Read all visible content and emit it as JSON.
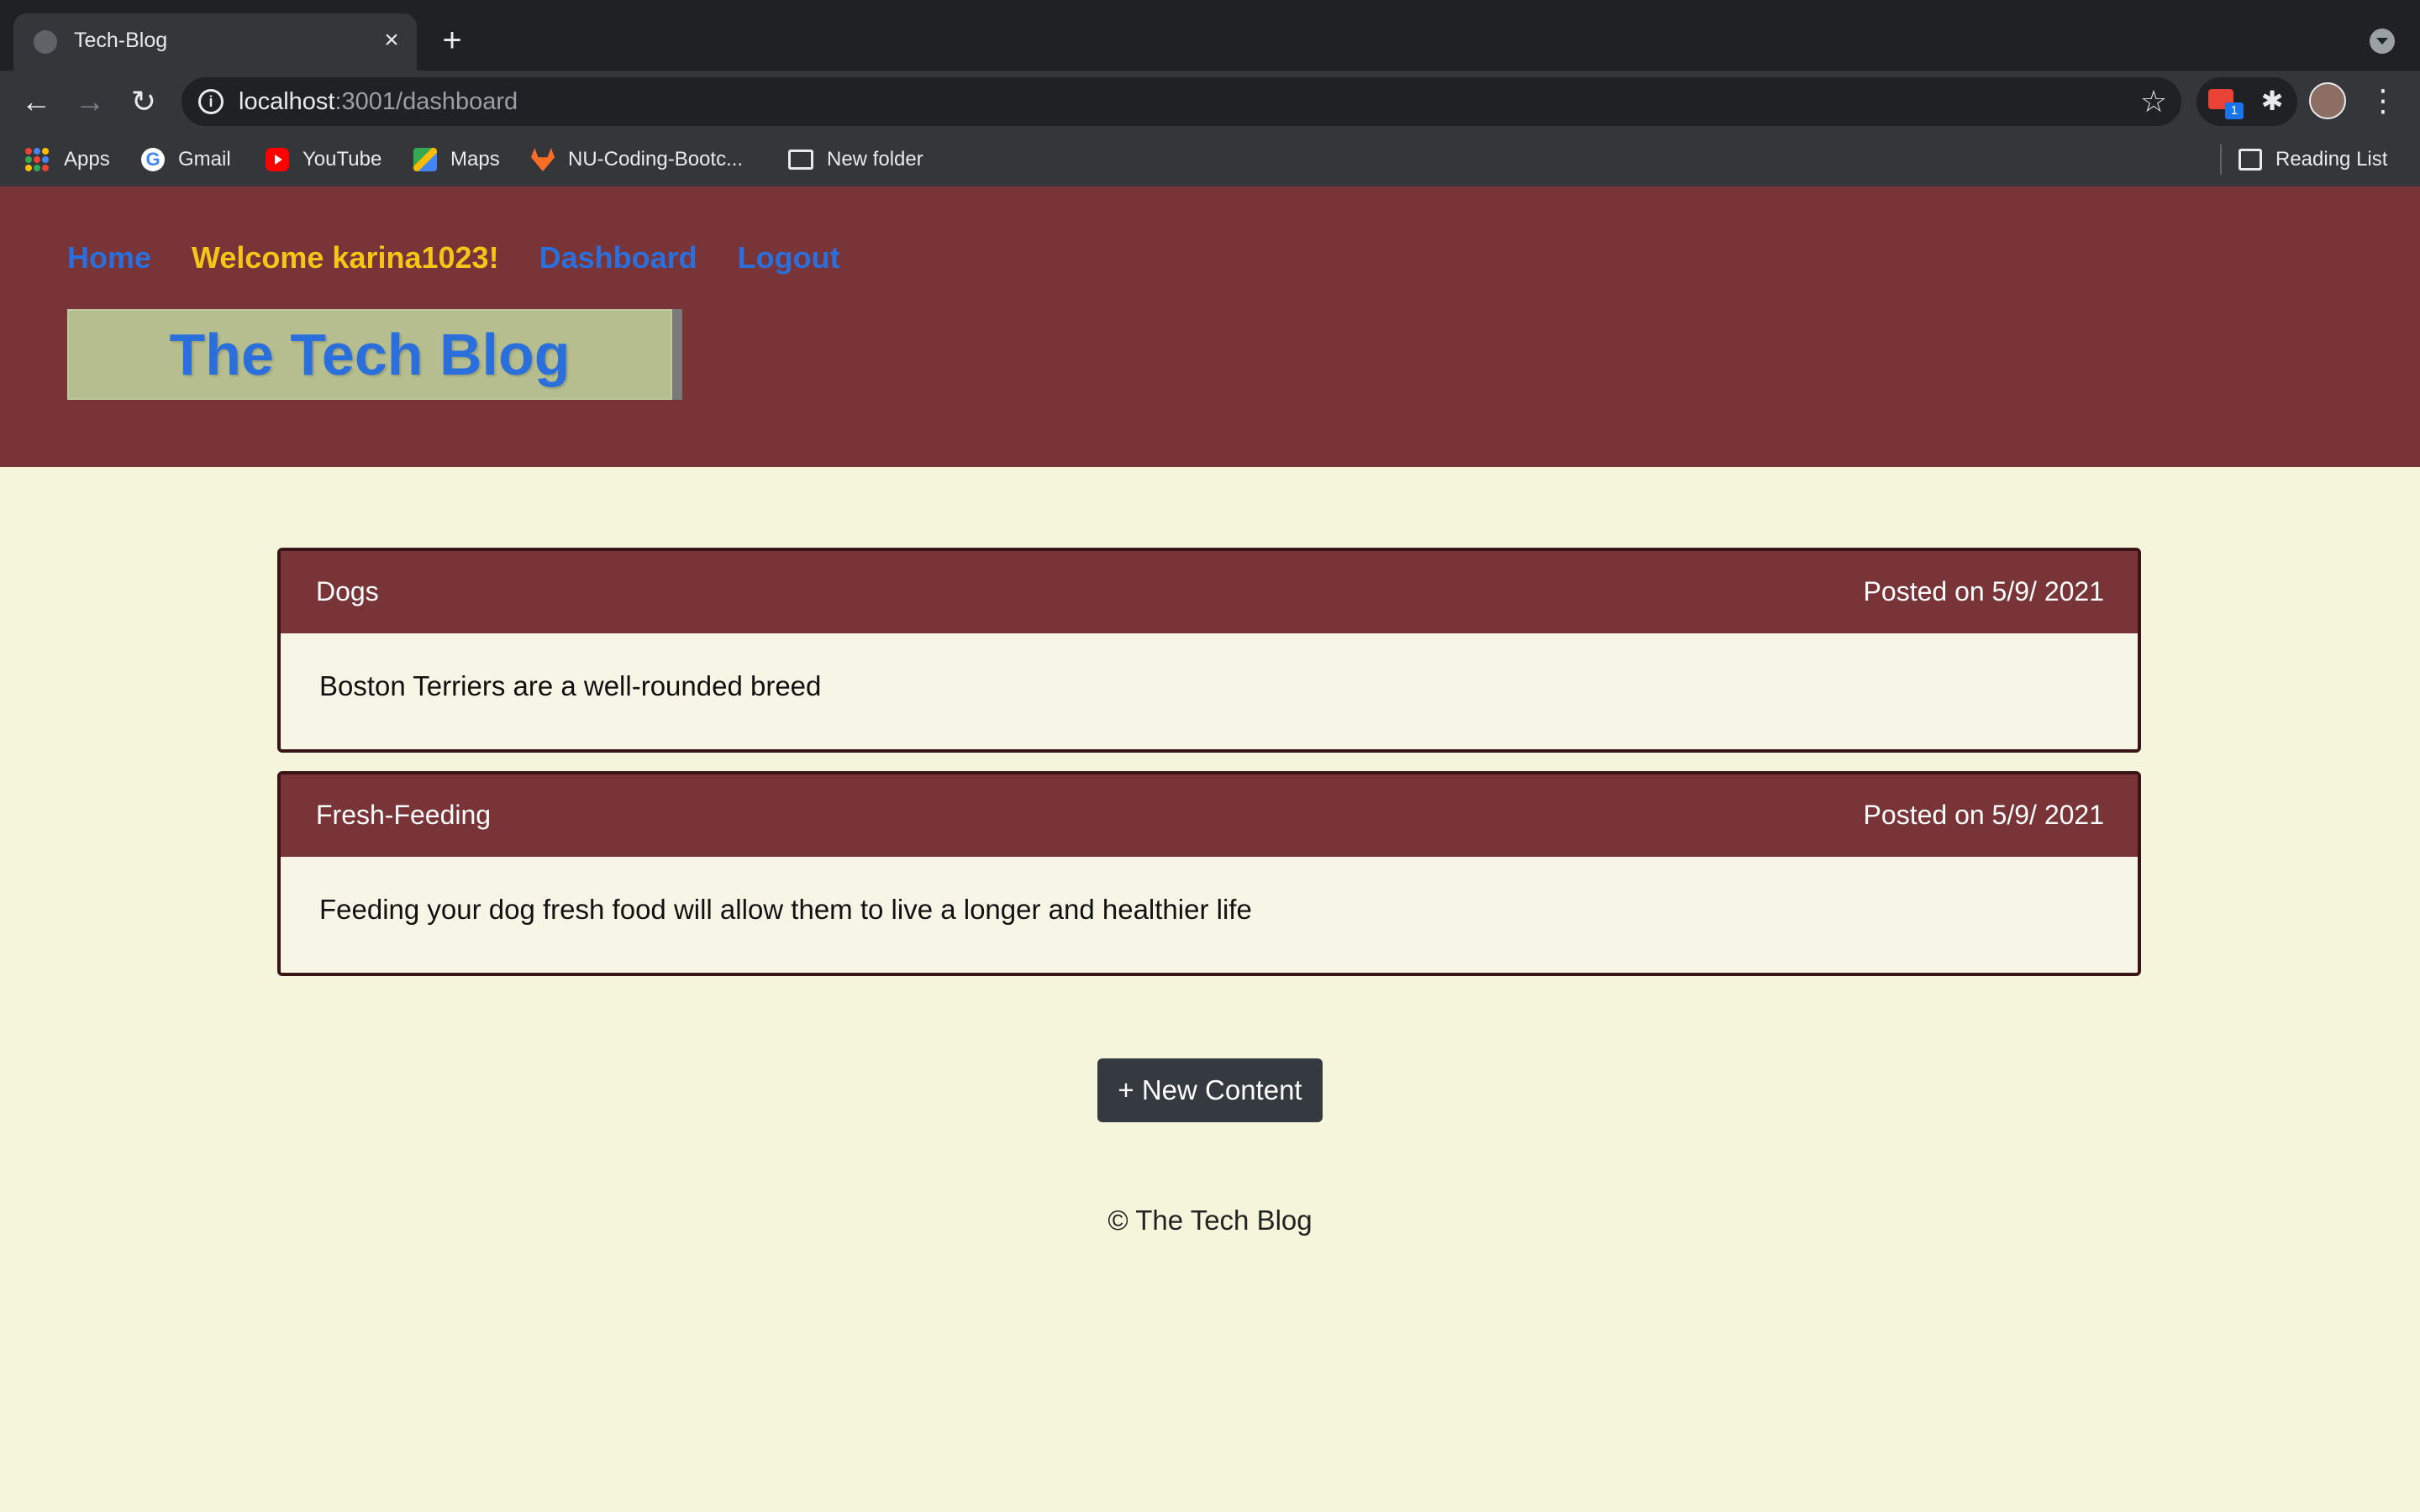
{
  "browser": {
    "tab_title": "Tech-Blog",
    "url_host": "localhost",
    "url_path": ":3001/dashboard",
    "extension_badge": "1",
    "bookmarks": [
      {
        "label": "Apps",
        "icon": "apps-grid-icon"
      },
      {
        "label": "Gmail",
        "icon": "google-icon"
      },
      {
        "label": "YouTube",
        "icon": "youtube-icon"
      },
      {
        "label": "Maps",
        "icon": "maps-icon"
      },
      {
        "label": "NU-Coding-Bootc...",
        "icon": "gitlab-icon"
      },
      {
        "label": "New folder",
        "icon": "folder-icon"
      }
    ],
    "reading_list": "Reading List"
  },
  "site": {
    "nav": {
      "home": "Home",
      "welcome": "Welcome karina1023!",
      "dashboard": "Dashboard",
      "logout": "Logout"
    },
    "logo": "The Tech Blog",
    "colors": {
      "header_bg": "#793438",
      "page_bg": "#f5f5dc",
      "nav_link": "#2a6fdb",
      "welcome": "#f5c518",
      "logo_bg": "#b6be8f",
      "button_bg": "#343a40"
    }
  },
  "posts": [
    {
      "title": "Dogs",
      "date": "Posted on 5/9/ 2021",
      "content": "Boston Terriers are a well-rounded breed"
    },
    {
      "title": "Fresh-Feeding",
      "date": "Posted on 5/9/ 2021",
      "content": "Feeding your dog fresh food will allow them to live a longer and healthier life"
    }
  ],
  "new_content_button": "+ New Content",
  "footer": "© The Tech Blog"
}
